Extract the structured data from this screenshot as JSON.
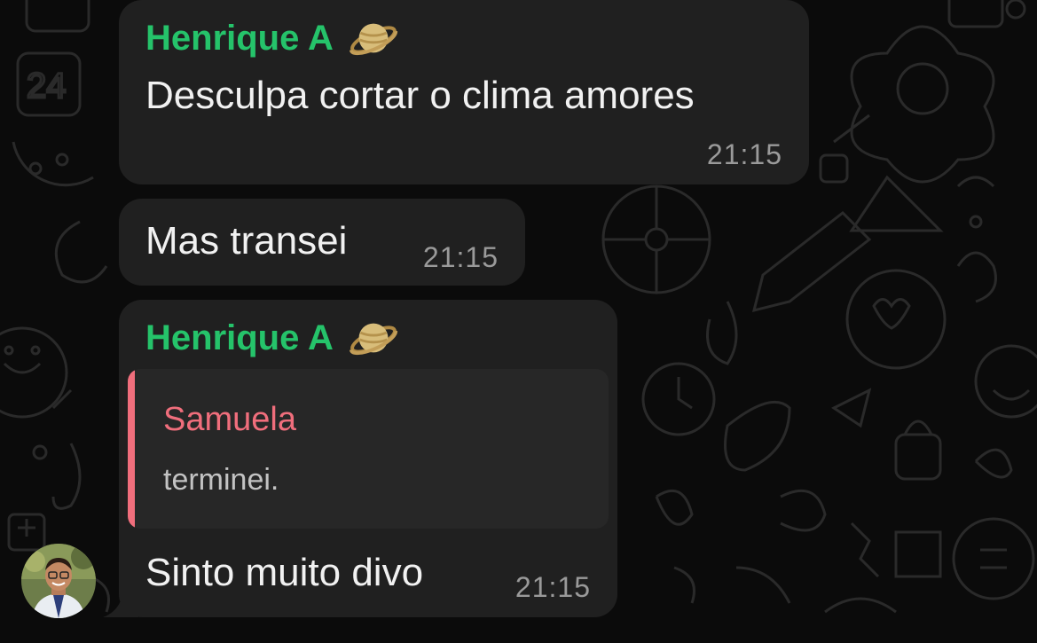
{
  "theme": {
    "background": "#0b0b0b",
    "bubble": "#202020",
    "sender_color": "#25c36a",
    "quote_author_color": "#f06e7c",
    "text": "#f1f1f1",
    "time": "#9a9a9a"
  },
  "messages": [
    {
      "sender": "Henrique A",
      "sender_icon": "ringed-planet-icon",
      "text": "Desculpa cortar o clima amores",
      "time": "21:15"
    },
    {
      "text": "Mas transei",
      "time": "21:15"
    },
    {
      "sender": "Henrique A",
      "sender_icon": "ringed-planet-icon",
      "reply": {
        "author": "Samuela",
        "text": "terminei."
      },
      "text": "Sinto muito divo",
      "time": "21:15"
    }
  ],
  "avatar": {
    "icon": "user-avatar-photo"
  }
}
